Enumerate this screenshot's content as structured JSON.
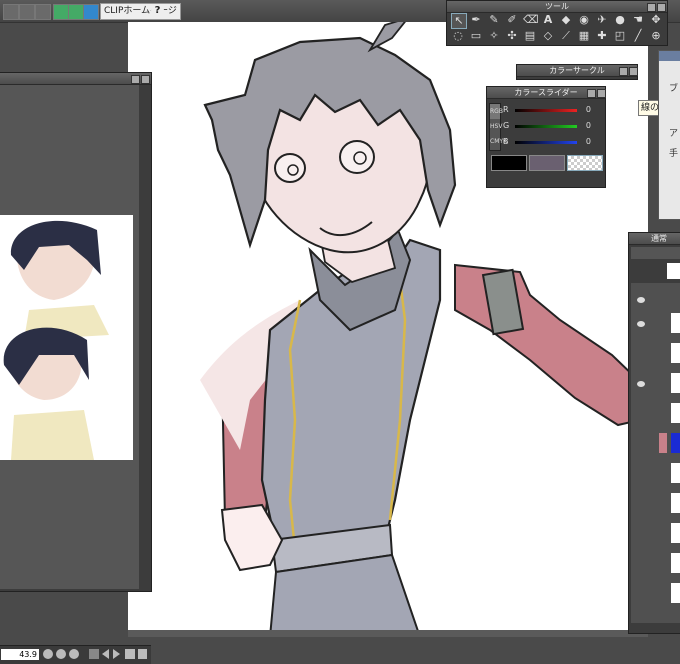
{
  "toolbar": {
    "homepage_label": "CLIPホームページ",
    "help_glyph": "?"
  },
  "tool_palette": {
    "title": "ツール"
  },
  "color_circle": {
    "title": "カラーサークル"
  },
  "color_slider": {
    "title": "カラースライダー",
    "tabs": [
      "RGB",
      "HSV",
      "CMYK"
    ],
    "channels": [
      {
        "label": "R",
        "value": "0",
        "color": "#cc2222"
      },
      {
        "label": "G",
        "value": "0",
        "color": "#22aa22"
      },
      {
        "label": "B",
        "value": "0",
        "color": "#2244cc"
      }
    ],
    "main_color": "#000000",
    "sub_color": "#6a6070"
  },
  "tooltip": {
    "text": "線の太さ(ブ"
  },
  "pen_panel": {
    "labels": [
      "ブ",
      "ア",
      "手"
    ]
  },
  "layer_panel": {
    "title": "通常",
    "blend_mode": "通常"
  },
  "sub_view": {
    "zoom_value": "43.9"
  },
  "colors": {
    "canvas": "#ffffff",
    "panel": "#3c3c3c",
    "skin": "#f3e3e3",
    "hair": "#9b9ba3",
    "vest": "#a3a6b4",
    "sleeve": "#c9818a"
  }
}
